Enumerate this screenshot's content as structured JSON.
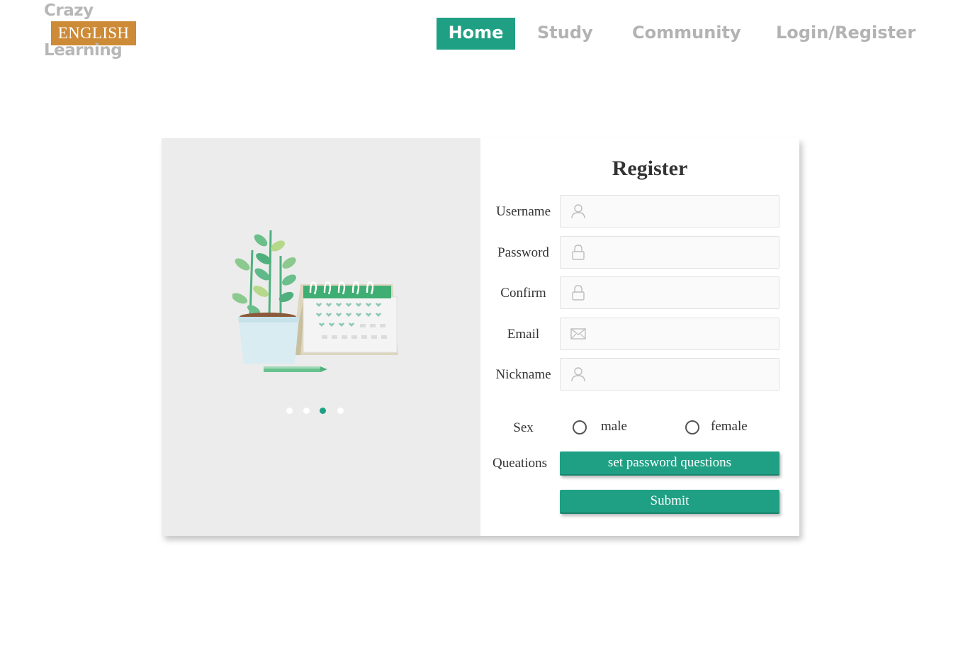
{
  "logo": {
    "line1": "Crazy",
    "badge": "ENGLISH",
    "line3": "Learning"
  },
  "nav": {
    "items": [
      {
        "label": "Home",
        "active": true
      },
      {
        "label": "Study",
        "active": false
      },
      {
        "label": "Community",
        "active": false
      },
      {
        "label": "Login/Register",
        "active": false
      }
    ]
  },
  "carousel": {
    "slide_count": 4,
    "active_index": 2
  },
  "form": {
    "title": "Register",
    "fields": [
      {
        "label": "Username",
        "icon": "user-icon",
        "value": ""
      },
      {
        "label": "Password",
        "icon": "lock-icon",
        "value": ""
      },
      {
        "label": "Confirm",
        "icon": "lock-icon",
        "value": ""
      },
      {
        "label": "Email",
        "icon": "mail-icon",
        "value": ""
      },
      {
        "label": "Nickname",
        "icon": "user-icon",
        "value": ""
      }
    ],
    "sex": {
      "label": "Sex",
      "options": [
        "male",
        "female"
      ],
      "selected": null
    },
    "questions": {
      "label": "Queations",
      "button": "set password questions"
    },
    "submit": "Submit"
  },
  "colors": {
    "accent": "#1fa084",
    "logo_badge": "#cd8a37",
    "nav_inactive": "#b3b3b3",
    "panel_left": "#ececec"
  }
}
